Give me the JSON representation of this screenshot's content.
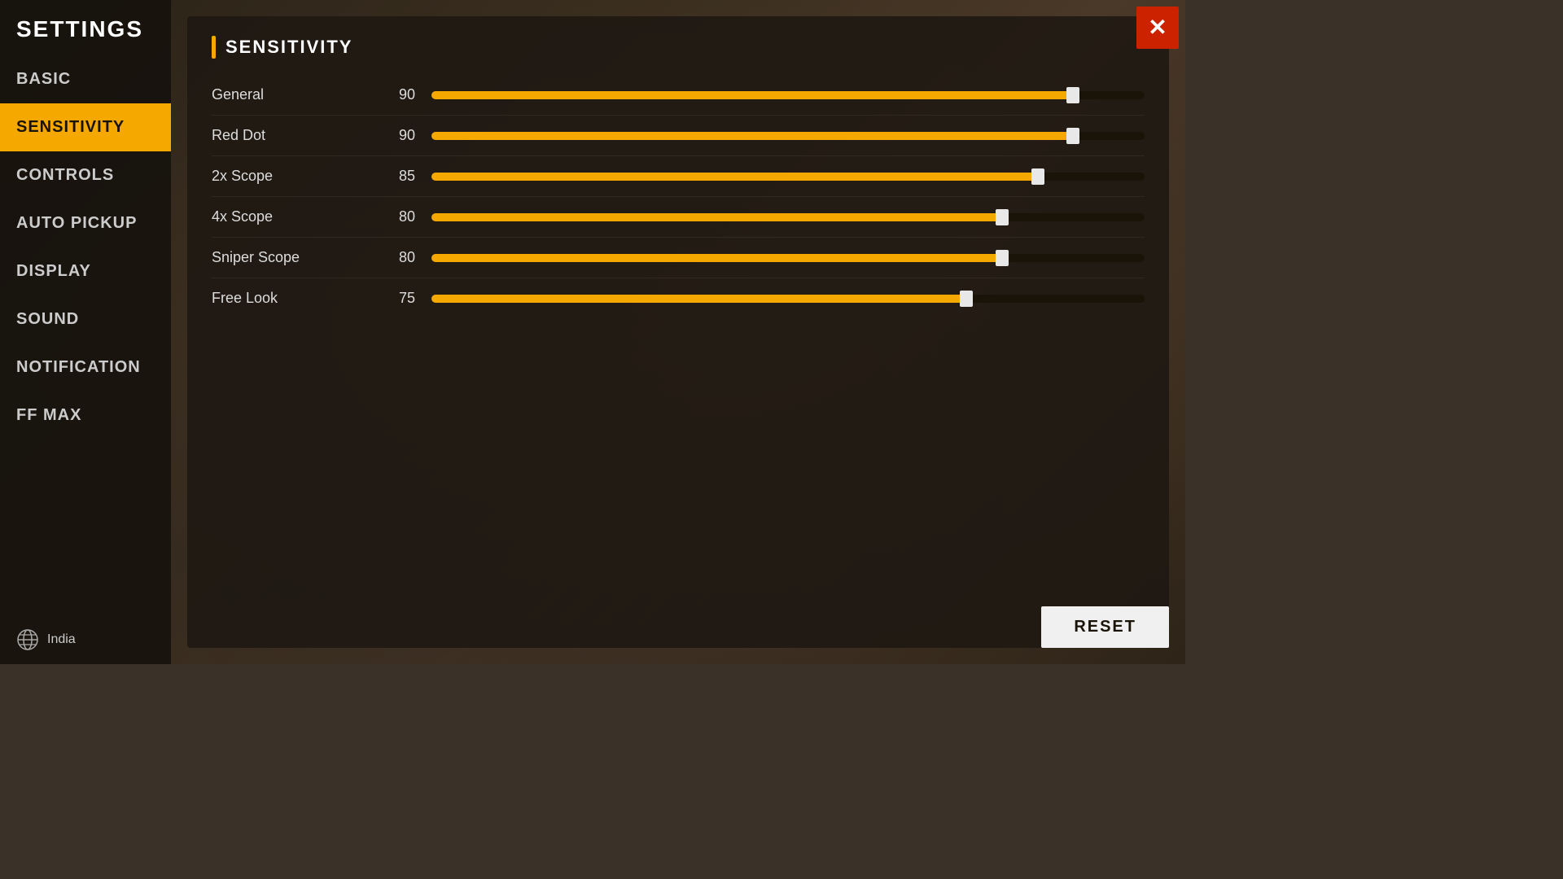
{
  "app": {
    "title": "SETTINGS"
  },
  "sidebar": {
    "items": [
      {
        "id": "basic",
        "label": "BASIC",
        "active": false
      },
      {
        "id": "sensitivity",
        "label": "SENSITIVITY",
        "active": true
      },
      {
        "id": "controls",
        "label": "CONTROLS",
        "active": false
      },
      {
        "id": "auto-pickup",
        "label": "AUTO PICKUP",
        "active": false
      },
      {
        "id": "display",
        "label": "DISPLAY",
        "active": false
      },
      {
        "id": "sound",
        "label": "SOUND",
        "active": false
      },
      {
        "id": "notification",
        "label": "NOTIFICATION",
        "active": false
      },
      {
        "id": "ff-max",
        "label": "FF MAX",
        "active": false
      }
    ],
    "footer": {
      "region": "India"
    }
  },
  "sensitivity": {
    "section_title": "SENSITIVITY",
    "rows": [
      {
        "label": "General",
        "value": 90,
        "percent": 90
      },
      {
        "label": "Red Dot",
        "value": 90,
        "percent": 90
      },
      {
        "label": "2x Scope",
        "value": 85,
        "percent": 85
      },
      {
        "label": "4x Scope",
        "value": 80,
        "percent": 80
      },
      {
        "label": "Sniper Scope",
        "value": 80,
        "percent": 80
      },
      {
        "label": "Free Look",
        "value": 75,
        "percent": 75
      }
    ]
  },
  "buttons": {
    "reset": "RESET",
    "close": "✕"
  },
  "colors": {
    "accent": "#f5a800",
    "active_nav_bg": "#f5a800",
    "close_btn": "#cc2200"
  }
}
